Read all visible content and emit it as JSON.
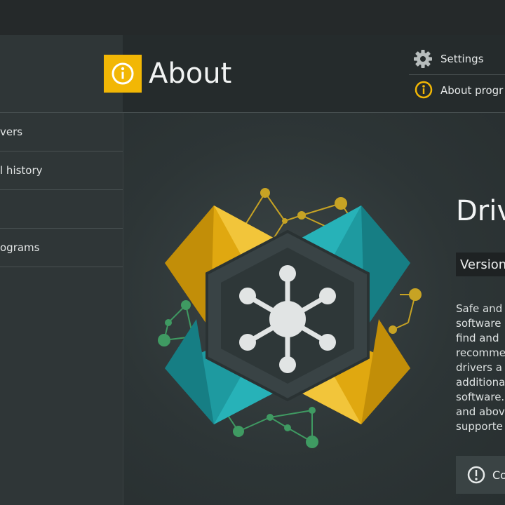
{
  "sidebar": {
    "items": [
      {
        "label": "vers"
      },
      {
        "label": "l history"
      },
      {
        "label": ""
      },
      {
        "label": "ograms"
      }
    ]
  },
  "header": {
    "title": "About",
    "menu": [
      {
        "label": "Settings",
        "icon": "gear-icon"
      },
      {
        "label": "About progr",
        "icon": "info-icon"
      }
    ]
  },
  "about": {
    "app_name": "Driv",
    "version_label": "Version",
    "description_lines": [
      "Safe and",
      "software",
      "find and",
      "recomme",
      "drivers a",
      "additiona",
      "software.",
      "and abov",
      "supporte"
    ],
    "contact_label": "Co"
  },
  "colors": {
    "accent": "#f2b705",
    "teal": "#1e9aa0",
    "gold": "#e0a810",
    "green": "#3fa66b"
  }
}
